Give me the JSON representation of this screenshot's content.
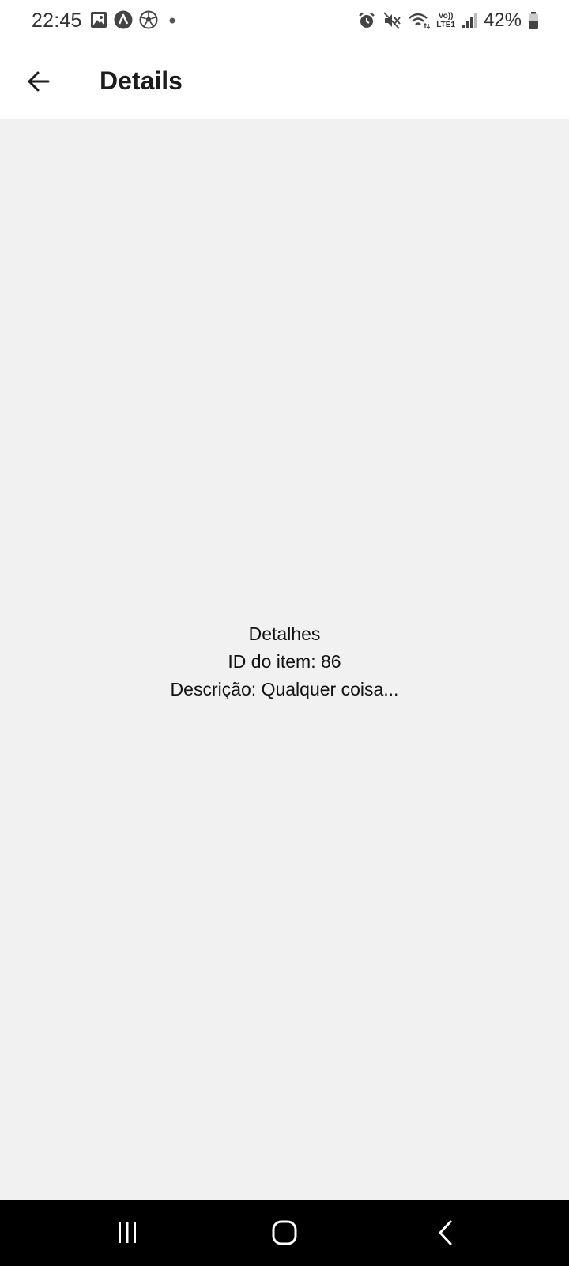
{
  "status_bar": {
    "time": "22:45",
    "left_icons": [
      "gallery-icon",
      "app-a-icon",
      "soccer-ball-icon",
      "notification-dot-icon"
    ],
    "right_icons": [
      "alarm-icon",
      "mute-icon",
      "wifi-icon",
      "volte-icon",
      "signal-icon",
      "battery-icon"
    ],
    "volte_top": "Vo))",
    "volte_bottom": "LTE1",
    "battery": "42%"
  },
  "app_bar": {
    "back_icon": "arrow-back-icon",
    "title": "Details"
  },
  "content": {
    "heading": "Detalhes",
    "item_id": "ID do item: 86",
    "description": "Descrição: Qualquer coisa..."
  },
  "nav_bar": {
    "buttons": [
      "recent-apps-icon",
      "home-icon",
      "back-chevron-icon"
    ]
  },
  "colors": {
    "app_bar_bg": "#ffffff",
    "content_bg": "#f1f1f1",
    "nav_bar_bg": "#000000",
    "text": "#1c1c1c"
  }
}
